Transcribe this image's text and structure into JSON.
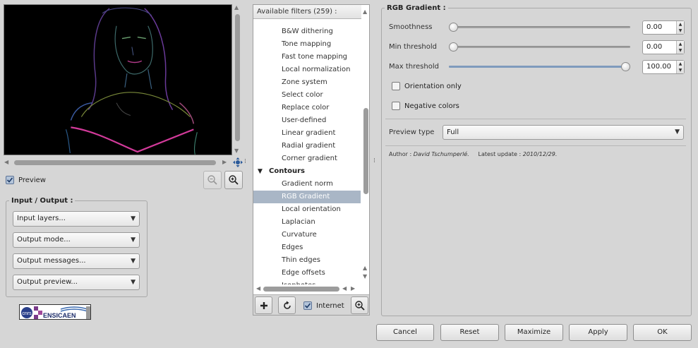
{
  "preview": {
    "checkbox_label": "Preview",
    "checked": true
  },
  "io": {
    "title": "Input / Output :",
    "combos": [
      {
        "label": "Input layers..."
      },
      {
        "label": "Output mode..."
      },
      {
        "label": "Output messages..."
      },
      {
        "label": "Output preview..."
      }
    ]
  },
  "logo": {
    "text": "ENSICAEN"
  },
  "filters": {
    "header": "Available filters (259) :",
    "items": [
      {
        "label": "B&W dithering",
        "type": "item"
      },
      {
        "label": "Tone mapping",
        "type": "item"
      },
      {
        "label": "Fast tone mapping",
        "type": "item"
      },
      {
        "label": "Local normalization",
        "type": "item"
      },
      {
        "label": "Zone system",
        "type": "item"
      },
      {
        "label": "Select color",
        "type": "item"
      },
      {
        "label": "Replace color",
        "type": "item"
      },
      {
        "label": "User-defined",
        "type": "item"
      },
      {
        "label": "Linear gradient",
        "type": "item"
      },
      {
        "label": "Radial gradient",
        "type": "item"
      },
      {
        "label": "Corner gradient",
        "type": "item"
      },
      {
        "label": "Contours",
        "type": "category"
      },
      {
        "label": "Gradient norm",
        "type": "item"
      },
      {
        "label": "RGB Gradient",
        "type": "item",
        "selected": true
      },
      {
        "label": "Local orientation",
        "type": "item"
      },
      {
        "label": "Laplacian",
        "type": "item"
      },
      {
        "label": "Curvature",
        "type": "item"
      },
      {
        "label": "Edges",
        "type": "item"
      },
      {
        "label": "Thin edges",
        "type": "item"
      },
      {
        "label": "Edge offsets",
        "type": "item"
      },
      {
        "label": "Isophotes",
        "type": "item"
      }
    ],
    "internet_label": "Internet",
    "internet_checked": true
  },
  "settings": {
    "title": "RGB Gradient :",
    "params": [
      {
        "label": "Smoothness",
        "value": "0.00",
        "fraction": 0.0
      },
      {
        "label": "Min threshold",
        "value": "0.00",
        "fraction": 0.0
      },
      {
        "label": "Max threshold",
        "value": "100.00",
        "fraction": 1.0
      }
    ],
    "checkboxes": [
      {
        "label": "Orientation only",
        "checked": false
      },
      {
        "label": "Negative colors",
        "checked": false
      }
    ],
    "preview_type_label": "Preview type",
    "preview_type_value": "Full",
    "author_label": "Author :",
    "author_name": "David Tschumperlé.",
    "update_label": "Latest update :",
    "update_date": "2010/12/29."
  },
  "buttons": {
    "cancel": "Cancel",
    "reset": "Reset",
    "maximize": "Maximize",
    "apply": "Apply",
    "ok": "OK"
  },
  "colors": {
    "selection": "#a9b6c6",
    "panel_bg": "#d6d6d6",
    "slider_fill": "#7f9bbd"
  }
}
